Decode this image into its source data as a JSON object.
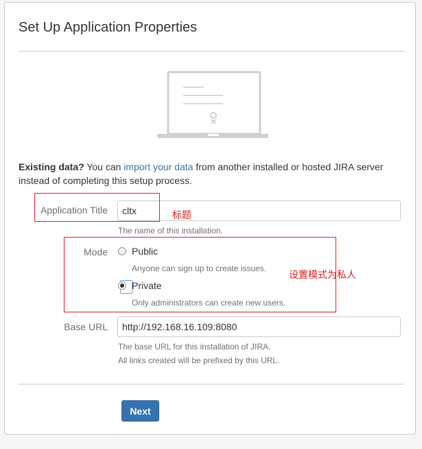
{
  "page": {
    "title": "Set Up Application Properties"
  },
  "existing_data": {
    "lead": "Existing data?",
    "text_before": " You can ",
    "link": "import your data",
    "text_after": " from another installed or hosted JIRA server instead of completing this setup process."
  },
  "form": {
    "app_title": {
      "label": "Application Title",
      "value": "cltx",
      "description": "The name of this installation."
    },
    "mode": {
      "label": "Mode",
      "options": [
        {
          "label": "Public",
          "description": "Anyone can sign up to create issues.",
          "selected": false
        },
        {
          "label": "Private",
          "description": "Only administrators can create new users.",
          "selected": true
        }
      ]
    },
    "base_url": {
      "label": "Base URL",
      "value": "http://192.168.16.109:8080",
      "description_line1": "The base URL for this installation of JIRA.",
      "description_line2": "All links created will be prefixed by this URL."
    },
    "next_label": "Next"
  },
  "annotations": {
    "title_note": "标题",
    "mode_note": "设置模式为私人"
  },
  "colors": {
    "accent": "#3572b0",
    "link": "#3b73af",
    "annotation": "#e02020"
  }
}
